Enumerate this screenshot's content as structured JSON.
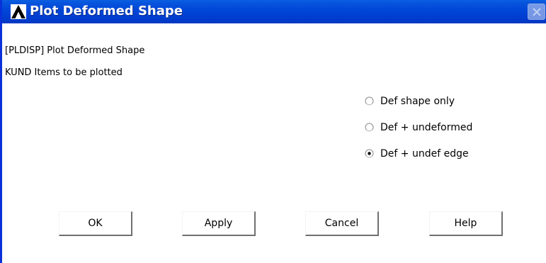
{
  "window": {
    "title": "Plot Deformed Shape"
  },
  "dialog": {
    "command_label": "[PLDISP]  Plot Deformed Shape",
    "kund_label": "KUND   Items to be plotted",
    "options": [
      {
        "label": "Def shape only",
        "selected": false
      },
      {
        "label": "Def + undeformed",
        "selected": false
      },
      {
        "label": "Def + undef edge",
        "selected": true
      }
    ]
  },
  "buttons": {
    "ok": "OK",
    "apply": "Apply",
    "cancel": "Cancel",
    "help": "Help"
  },
  "colors": {
    "titlebar": "#0046d8",
    "window_border": "#0831d9",
    "background": "#ffffff"
  }
}
